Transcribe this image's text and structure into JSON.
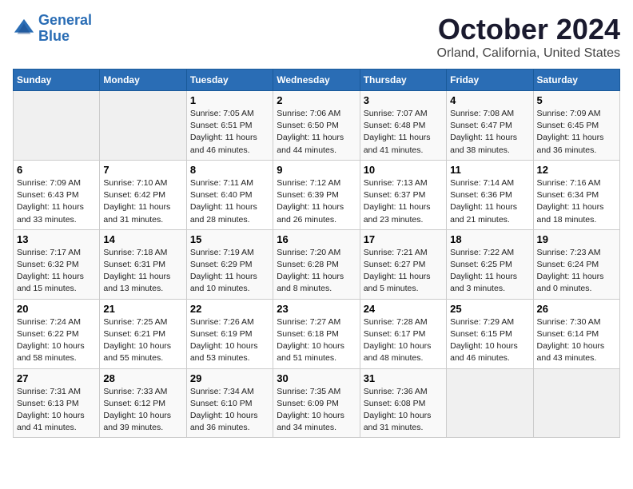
{
  "header": {
    "logo_line1": "General",
    "logo_line2": "Blue",
    "month": "October 2024",
    "location": "Orland, California, United States"
  },
  "days_of_week": [
    "Sunday",
    "Monday",
    "Tuesday",
    "Wednesday",
    "Thursday",
    "Friday",
    "Saturday"
  ],
  "weeks": [
    [
      {
        "day": "",
        "info": ""
      },
      {
        "day": "",
        "info": ""
      },
      {
        "day": "1",
        "info": "Sunrise: 7:05 AM\nSunset: 6:51 PM\nDaylight: 11 hours and 46 minutes."
      },
      {
        "day": "2",
        "info": "Sunrise: 7:06 AM\nSunset: 6:50 PM\nDaylight: 11 hours and 44 minutes."
      },
      {
        "day": "3",
        "info": "Sunrise: 7:07 AM\nSunset: 6:48 PM\nDaylight: 11 hours and 41 minutes."
      },
      {
        "day": "4",
        "info": "Sunrise: 7:08 AM\nSunset: 6:47 PM\nDaylight: 11 hours and 38 minutes."
      },
      {
        "day": "5",
        "info": "Sunrise: 7:09 AM\nSunset: 6:45 PM\nDaylight: 11 hours and 36 minutes."
      }
    ],
    [
      {
        "day": "6",
        "info": "Sunrise: 7:09 AM\nSunset: 6:43 PM\nDaylight: 11 hours and 33 minutes."
      },
      {
        "day": "7",
        "info": "Sunrise: 7:10 AM\nSunset: 6:42 PM\nDaylight: 11 hours and 31 minutes."
      },
      {
        "day": "8",
        "info": "Sunrise: 7:11 AM\nSunset: 6:40 PM\nDaylight: 11 hours and 28 minutes."
      },
      {
        "day": "9",
        "info": "Sunrise: 7:12 AM\nSunset: 6:39 PM\nDaylight: 11 hours and 26 minutes."
      },
      {
        "day": "10",
        "info": "Sunrise: 7:13 AM\nSunset: 6:37 PM\nDaylight: 11 hours and 23 minutes."
      },
      {
        "day": "11",
        "info": "Sunrise: 7:14 AM\nSunset: 6:36 PM\nDaylight: 11 hours and 21 minutes."
      },
      {
        "day": "12",
        "info": "Sunrise: 7:16 AM\nSunset: 6:34 PM\nDaylight: 11 hours and 18 minutes."
      }
    ],
    [
      {
        "day": "13",
        "info": "Sunrise: 7:17 AM\nSunset: 6:32 PM\nDaylight: 11 hours and 15 minutes."
      },
      {
        "day": "14",
        "info": "Sunrise: 7:18 AM\nSunset: 6:31 PM\nDaylight: 11 hours and 13 minutes."
      },
      {
        "day": "15",
        "info": "Sunrise: 7:19 AM\nSunset: 6:29 PM\nDaylight: 11 hours and 10 minutes."
      },
      {
        "day": "16",
        "info": "Sunrise: 7:20 AM\nSunset: 6:28 PM\nDaylight: 11 hours and 8 minutes."
      },
      {
        "day": "17",
        "info": "Sunrise: 7:21 AM\nSunset: 6:27 PM\nDaylight: 11 hours and 5 minutes."
      },
      {
        "day": "18",
        "info": "Sunrise: 7:22 AM\nSunset: 6:25 PM\nDaylight: 11 hours and 3 minutes."
      },
      {
        "day": "19",
        "info": "Sunrise: 7:23 AM\nSunset: 6:24 PM\nDaylight: 11 hours and 0 minutes."
      }
    ],
    [
      {
        "day": "20",
        "info": "Sunrise: 7:24 AM\nSunset: 6:22 PM\nDaylight: 10 hours and 58 minutes."
      },
      {
        "day": "21",
        "info": "Sunrise: 7:25 AM\nSunset: 6:21 PM\nDaylight: 10 hours and 55 minutes."
      },
      {
        "day": "22",
        "info": "Sunrise: 7:26 AM\nSunset: 6:19 PM\nDaylight: 10 hours and 53 minutes."
      },
      {
        "day": "23",
        "info": "Sunrise: 7:27 AM\nSunset: 6:18 PM\nDaylight: 10 hours and 51 minutes."
      },
      {
        "day": "24",
        "info": "Sunrise: 7:28 AM\nSunset: 6:17 PM\nDaylight: 10 hours and 48 minutes."
      },
      {
        "day": "25",
        "info": "Sunrise: 7:29 AM\nSunset: 6:15 PM\nDaylight: 10 hours and 46 minutes."
      },
      {
        "day": "26",
        "info": "Sunrise: 7:30 AM\nSunset: 6:14 PM\nDaylight: 10 hours and 43 minutes."
      }
    ],
    [
      {
        "day": "27",
        "info": "Sunrise: 7:31 AM\nSunset: 6:13 PM\nDaylight: 10 hours and 41 minutes."
      },
      {
        "day": "28",
        "info": "Sunrise: 7:33 AM\nSunset: 6:12 PM\nDaylight: 10 hours and 39 minutes."
      },
      {
        "day": "29",
        "info": "Sunrise: 7:34 AM\nSunset: 6:10 PM\nDaylight: 10 hours and 36 minutes."
      },
      {
        "day": "30",
        "info": "Sunrise: 7:35 AM\nSunset: 6:09 PM\nDaylight: 10 hours and 34 minutes."
      },
      {
        "day": "31",
        "info": "Sunrise: 7:36 AM\nSunset: 6:08 PM\nDaylight: 10 hours and 31 minutes."
      },
      {
        "day": "",
        "info": ""
      },
      {
        "day": "",
        "info": ""
      }
    ]
  ]
}
